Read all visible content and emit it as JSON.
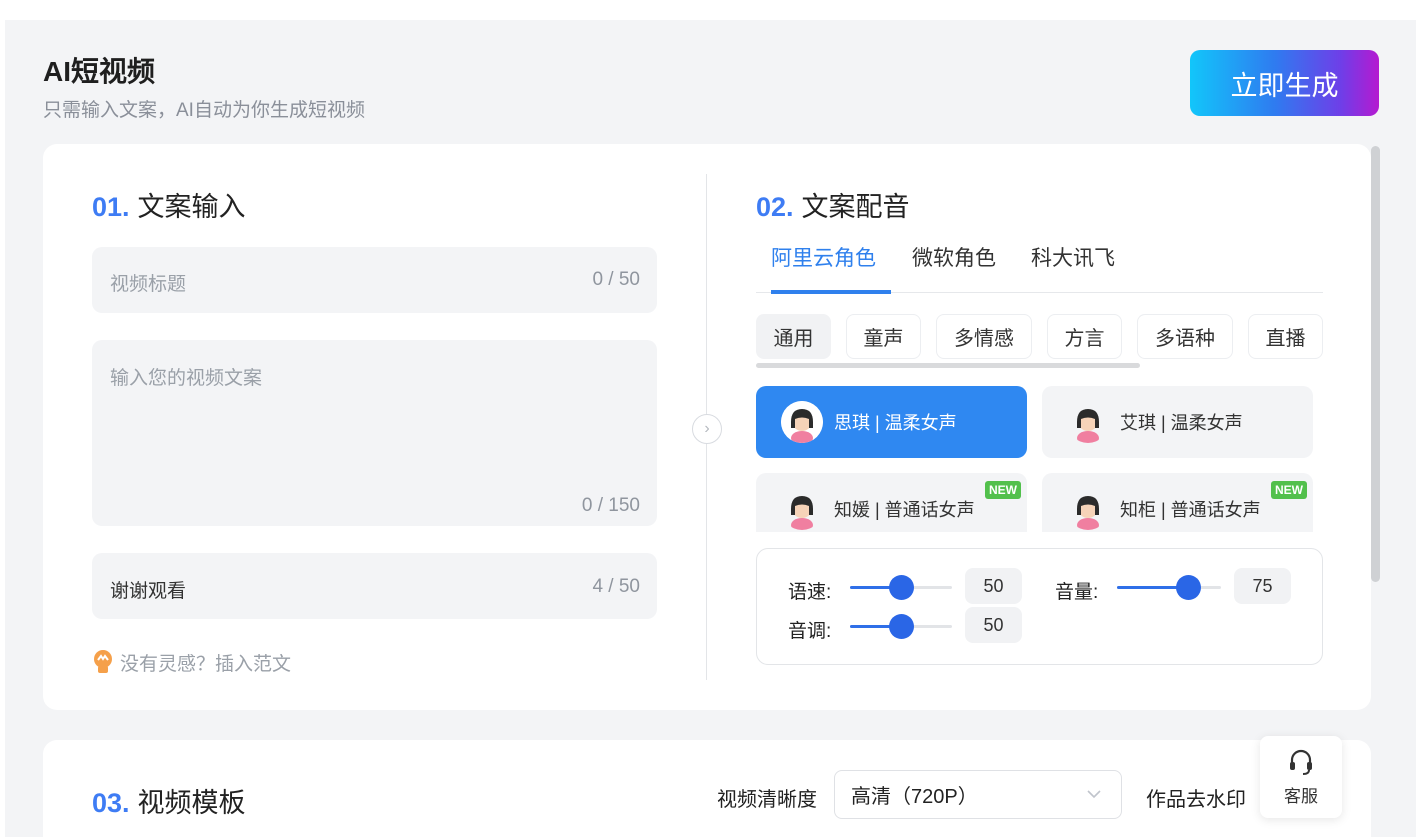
{
  "header": {
    "title": "AI短视频",
    "subtitle": "只需输入文案，AI自动为你生成短视频",
    "generate_label": "立即生成"
  },
  "script_input": {
    "section_num": "01.",
    "section_title": "文案输入",
    "title_field": {
      "placeholder": "视频标题",
      "count": "0 / 50"
    },
    "body_field": {
      "placeholder": "输入您的视频文案",
      "count": "0 / 150"
    },
    "ending_field": {
      "value": "谢谢观看",
      "count": "4 / 50"
    },
    "hint": "没有灵感？插入范文"
  },
  "dubbing": {
    "section_num": "02.",
    "section_title": "文案配音",
    "providers": [
      {
        "label": "阿里云角色",
        "active": true
      },
      {
        "label": "微软角色",
        "active": false
      },
      {
        "label": "科大讯飞",
        "active": false
      }
    ],
    "categories": [
      {
        "label": "通用",
        "active": true
      },
      {
        "label": "童声",
        "active": false
      },
      {
        "label": "多情感",
        "active": false
      },
      {
        "label": "方言",
        "active": false
      },
      {
        "label": "多语种",
        "active": false
      },
      {
        "label": "直播",
        "active": false
      }
    ],
    "voices": [
      {
        "label": "思琪 | 温柔女声",
        "selected": true,
        "is_new": false
      },
      {
        "label": "艾琪 | 温柔女声",
        "selected": false,
        "is_new": false
      },
      {
        "label": "知媛 | 普通话女声",
        "selected": false,
        "is_new": true
      },
      {
        "label": "知柜 | 普通话女声",
        "selected": false,
        "is_new": true
      }
    ],
    "new_badge": "NEW",
    "controls": {
      "speed": {
        "label": "语速:",
        "value": "50",
        "level": 0.5
      },
      "volume": {
        "label": "音量:",
        "value": "75",
        "level": 0.68
      },
      "pitch": {
        "label": "音调:",
        "value": "50",
        "level": 0.5
      }
    }
  },
  "template": {
    "section_num": "03.",
    "section_title": "视频模板",
    "quality_label": "视频清晰度",
    "quality_value": "高清（720P）",
    "watermark_label": "作品去水印"
  },
  "service": {
    "label": "客服"
  },
  "colors": {
    "accent": "#2f80ed",
    "selected_voice_bg": "#2f88f1",
    "new_badge": "#52c04c"
  }
}
